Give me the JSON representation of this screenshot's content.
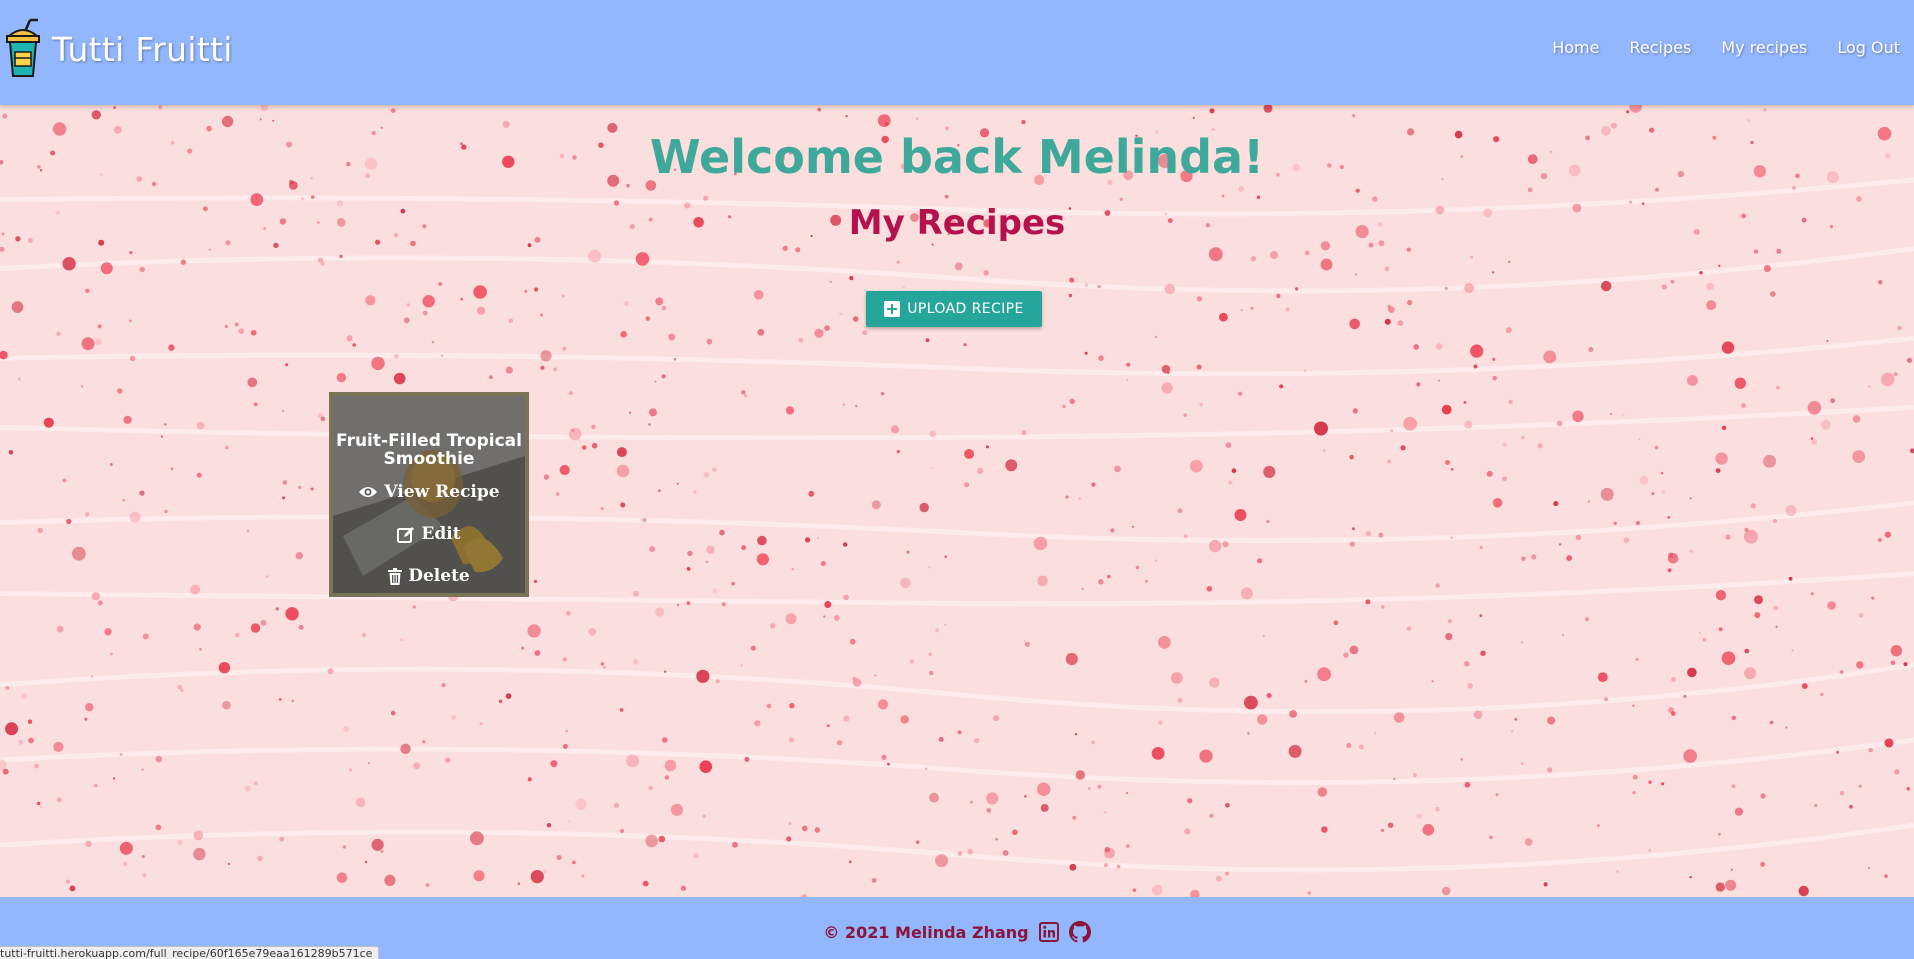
{
  "navbar": {
    "brand": "Tutti Fruitti",
    "links": [
      "Home",
      "Recipes",
      "My recipes",
      "Log Out"
    ]
  },
  "main": {
    "welcome": "Welcome back Melinda!",
    "subtitle": "My Recipes",
    "upload_button": "UPLOAD RECIPE"
  },
  "recipes": [
    {
      "title": "Fruit-Filled Tropical Smoothie",
      "actions": {
        "view": "View Recipe",
        "edit": "Edit",
        "delete": "Delete"
      }
    }
  ],
  "footer": {
    "copyright": "© 2021 Melinda Zhang",
    "icons": [
      "linkedin-icon",
      "github-icon"
    ]
  },
  "status_bar": {
    "url": "tutti-fruitti.herokuapp.com/full_recipe/60f165e79eaa161289b571ce"
  },
  "colors": {
    "navbar": "#93b7ff",
    "welcome": "#3ea99a",
    "subtitle": "#b5124d",
    "button": "#26a69a",
    "footer_text": "#8b1538"
  }
}
